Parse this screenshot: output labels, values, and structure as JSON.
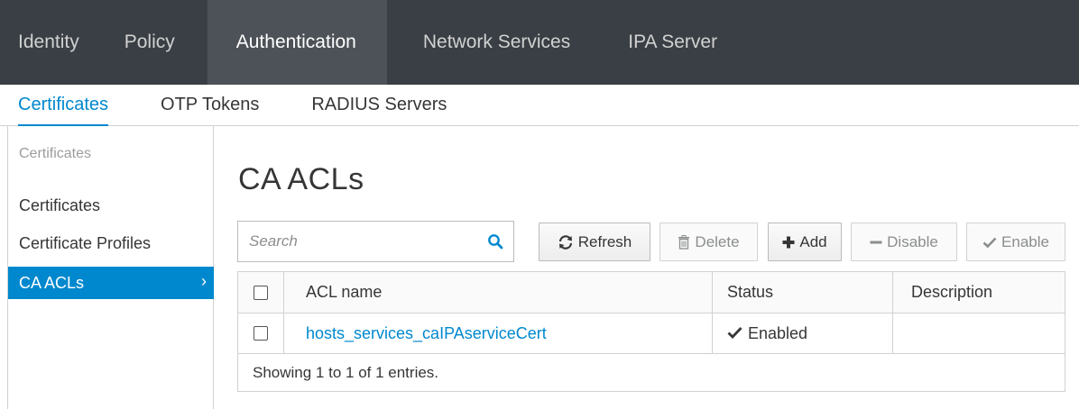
{
  "topnav": {
    "tabs": [
      {
        "label": "Identity",
        "active": false
      },
      {
        "label": "Policy",
        "active": false
      },
      {
        "label": "Authentication",
        "active": true
      },
      {
        "label": "Network Services",
        "active": false
      },
      {
        "label": "IPA Server",
        "active": false
      }
    ]
  },
  "subnav": {
    "tabs": [
      {
        "label": "Certificates",
        "active": true
      },
      {
        "label": "OTP Tokens",
        "active": false
      },
      {
        "label": "RADIUS Servers",
        "active": false
      }
    ]
  },
  "sidebar": {
    "heading": "Certificates",
    "items": [
      {
        "label": "Certificates",
        "active": false
      },
      {
        "label": "Certificate Profiles",
        "active": false
      },
      {
        "label": "CA ACLs",
        "active": true,
        "chevron": "›"
      }
    ]
  },
  "main": {
    "title": "CA ACLs",
    "search": {
      "placeholder": "Search",
      "icon": "search-icon"
    },
    "toolbar": {
      "refresh_label": "Refresh",
      "delete_label": "Delete",
      "add_label": "Add",
      "disable_label": "Disable",
      "enable_label": "Enable"
    },
    "table": {
      "columns": [
        "ACL name",
        "Status",
        "Description"
      ],
      "rows": [
        {
          "name": "hosts_services_caIPAserviceCert",
          "status": "Enabled",
          "description": ""
        }
      ],
      "footer": "Showing 1 to 1 of 1 entries."
    }
  },
  "colors": {
    "accent": "#0088ce",
    "topnav_bg": "#393f44",
    "topnav_active_bg": "#4d5258"
  }
}
